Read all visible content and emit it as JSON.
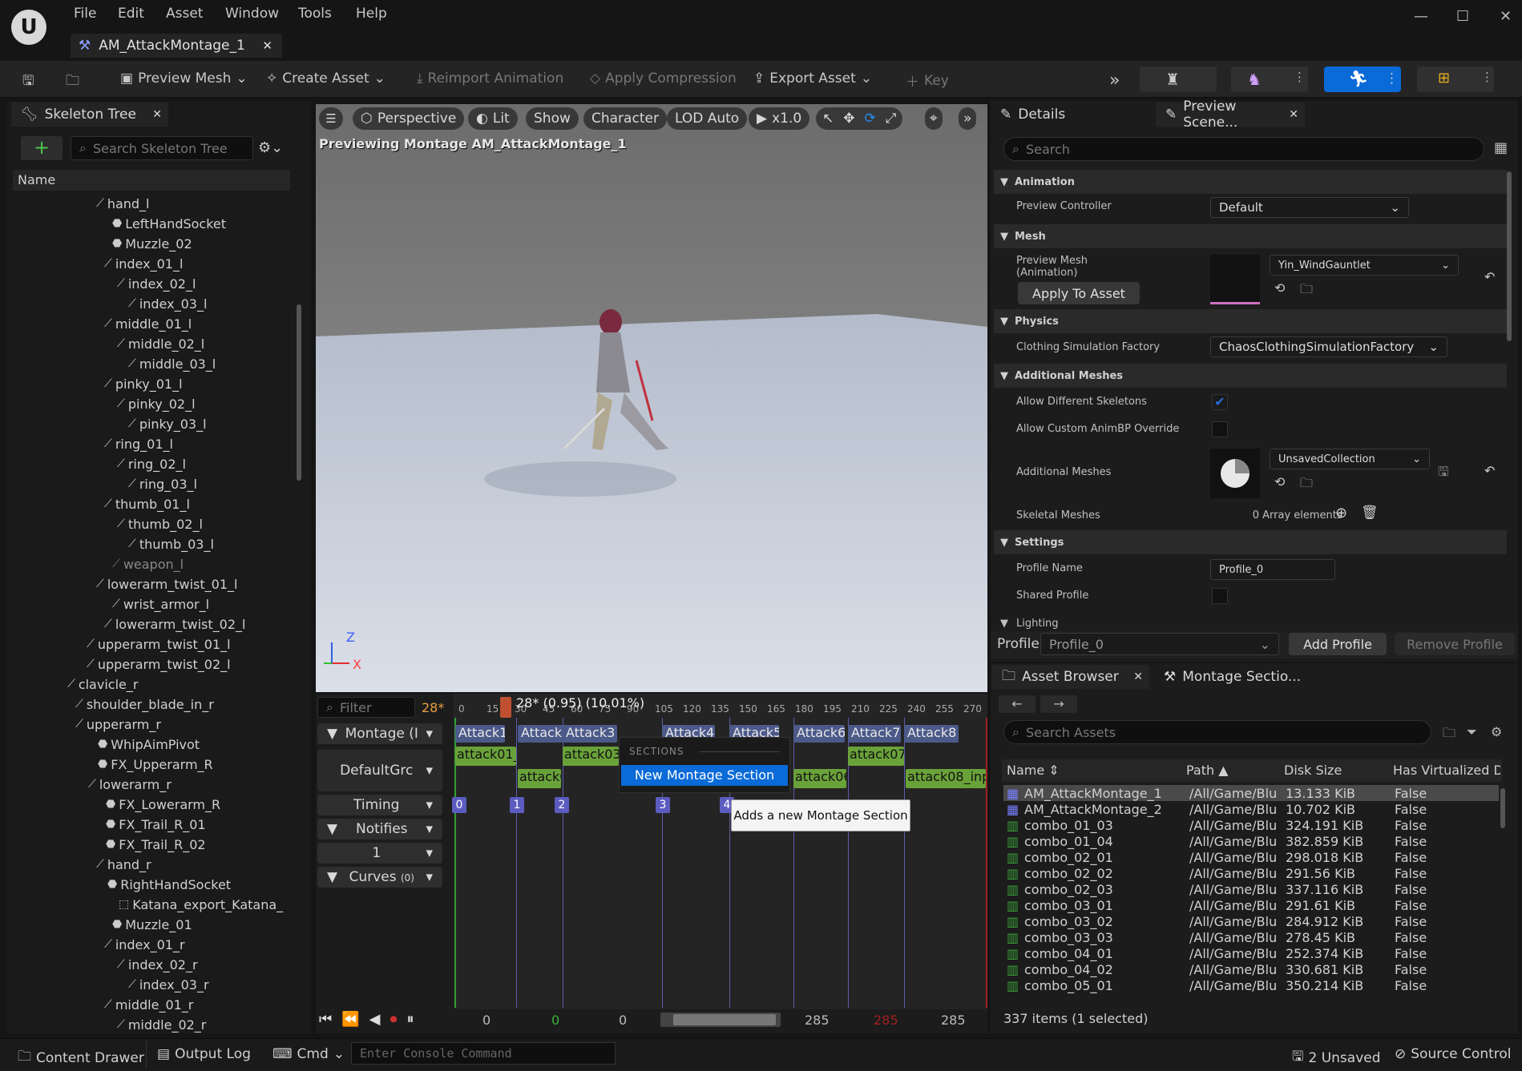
{
  "menu": {
    "items": [
      "File",
      "Edit",
      "Asset",
      "Window",
      "Tools",
      "Help"
    ]
  },
  "tab": {
    "title": "AM_AttackMontage_1"
  },
  "toolbar": {
    "preview_mesh": "Preview Mesh",
    "create_asset": "Create Asset",
    "reimport": "Reimport Animation",
    "apply_compression": "Apply Compression",
    "export_asset": "Export Asset",
    "key": "Key"
  },
  "skeleton_tree": {
    "tab": "Skeleton Tree",
    "search_placeholder": "Search Skeleton Tree",
    "column": "Name",
    "rows": [
      {
        "label": "hand_l",
        "type": "bone"
      },
      {
        "label": "LeftHandSocket",
        "type": "socket"
      },
      {
        "label": "Muzzle_02",
        "type": "socket"
      },
      {
        "label": "index_01_l",
        "type": "bone"
      },
      {
        "label": "index_02_l",
        "type": "bone"
      },
      {
        "label": "index_03_l",
        "type": "bone"
      },
      {
        "label": "middle_01_l",
        "type": "bone"
      },
      {
        "label": "middle_02_l",
        "type": "bone"
      },
      {
        "label": "middle_03_l",
        "type": "bone"
      },
      {
        "label": "pinky_01_l",
        "type": "bone"
      },
      {
        "label": "pinky_02_l",
        "type": "bone"
      },
      {
        "label": "pinky_03_l",
        "type": "bone"
      },
      {
        "label": "ring_01_l",
        "type": "bone"
      },
      {
        "label": "ring_02_l",
        "type": "bone"
      },
      {
        "label": "ring_03_l",
        "type": "bone"
      },
      {
        "label": "thumb_01_l",
        "type": "bone"
      },
      {
        "label": "thumb_02_l",
        "type": "bone"
      },
      {
        "label": "thumb_03_l",
        "type": "bone"
      },
      {
        "label": "weapon_l",
        "type": "bone-dim"
      },
      {
        "label": "lowerarm_twist_01_l",
        "type": "bone"
      },
      {
        "label": "wrist_armor_l",
        "type": "bone"
      },
      {
        "label": "lowerarm_twist_02_l",
        "type": "bone"
      },
      {
        "label": "upperarm_twist_01_l",
        "type": "bone"
      },
      {
        "label": "upperarm_twist_02_l",
        "type": "bone"
      },
      {
        "label": "clavicle_r",
        "type": "bone"
      },
      {
        "label": "shoulder_blade_in_r",
        "type": "bone"
      },
      {
        "label": "upperarm_r",
        "type": "bone"
      },
      {
        "label": "WhipAimPivot",
        "type": "socket"
      },
      {
        "label": "FX_Upperarm_R",
        "type": "socket"
      },
      {
        "label": "lowerarm_r",
        "type": "bone"
      },
      {
        "label": "FX_Lowerarm_R",
        "type": "socket"
      },
      {
        "label": "FX_Trail_R_01",
        "type": "socket"
      },
      {
        "label": "FX_Trail_R_02",
        "type": "socket"
      },
      {
        "label": "hand_r",
        "type": "bone"
      },
      {
        "label": "RightHandSocket",
        "type": "socket"
      },
      {
        "label": "Katana_export_Katana_",
        "type": "mesh"
      },
      {
        "label": "Muzzle_01",
        "type": "socket"
      },
      {
        "label": "index_01_r",
        "type": "bone"
      },
      {
        "label": "index_02_r",
        "type": "bone"
      },
      {
        "label": "index_03_r",
        "type": "bone"
      },
      {
        "label": "middle_01_r",
        "type": "bone"
      },
      {
        "label": "middle_02_r",
        "type": "bone"
      }
    ]
  },
  "viewport": {
    "buttons": [
      "Perspective",
      "Lit",
      "Show",
      "Character",
      "LOD Auto",
      "x1.0"
    ],
    "overlay": "Previewing Montage AM_AttackMontage_1",
    "axis_z": "Z",
    "axis_x": "X"
  },
  "details": {
    "tab": "Details",
    "tab2": "Preview Scene...",
    "search_placeholder": "Search",
    "sections": {
      "animation": "Animation",
      "mesh": "Mesh",
      "physics": "Physics",
      "additional_meshes": "Additional Meshes",
      "settings": "Settings",
      "lighting": "Lighting"
    },
    "preview_controller_label": "Preview Controller",
    "preview_controller_value": "Default",
    "preview_mesh_label": "Preview Mesh",
    "preview_mesh_sub": "(Animation)",
    "preview_mesh_value": "Yin_WindGauntlet",
    "apply_to_asset": "Apply To Asset",
    "clothing_label": "Clothing Simulation Factory",
    "clothing_value": "ChaosClothingSimulationFactory",
    "allow_diff_skel": "Allow Different Skeletons",
    "allow_custom_animbp": "Allow Custom AnimBP Override",
    "additional_meshes_label": "Additional Meshes",
    "additional_meshes_value": "UnsavedCollection",
    "skeletal_meshes_label": "Skeletal Meshes",
    "skeletal_meshes_value": "0 Array elements",
    "profile_name_label": "Profile Name",
    "profile_name_value": "Profile_0",
    "shared_profile": "Shared Profile",
    "profile_label": "Profile",
    "profile_value": "Profile_0",
    "add_profile": "Add Profile",
    "remove_profile": "Remove Profile"
  },
  "asset_browser": {
    "tab": "Asset Browser",
    "tab2": "Montage Sectio...",
    "search_placeholder": "Search Assets",
    "columns": [
      "Name",
      "Path",
      "Disk Size",
      "Has Virtualized D"
    ],
    "rows": [
      {
        "name": "AM_AttackMontage_1",
        "path": "/All/Game/Blu",
        "size": "13.133 KiB",
        "virt": "False",
        "kind": "montage"
      },
      {
        "name": "AM_AttackMontage_2",
        "path": "/All/Game/Blu",
        "size": "10.702 KiB",
        "virt": "False",
        "kind": "montage"
      },
      {
        "name": "combo_01_03",
        "path": "/All/Game/Blu",
        "size": "324.191 KiB",
        "virt": "False",
        "kind": "anim"
      },
      {
        "name": "combo_01_04",
        "path": "/All/Game/Blu",
        "size": "382.859 KiB",
        "virt": "False",
        "kind": "anim"
      },
      {
        "name": "combo_02_01",
        "path": "/All/Game/Blu",
        "size": "298.018 KiB",
        "virt": "False",
        "kind": "anim"
      },
      {
        "name": "combo_02_02",
        "path": "/All/Game/Blu",
        "size": "291.56 KiB",
        "virt": "False",
        "kind": "anim"
      },
      {
        "name": "combo_02_03",
        "path": "/All/Game/Blu",
        "size": "337.116 KiB",
        "virt": "False",
        "kind": "anim"
      },
      {
        "name": "combo_03_01",
        "path": "/All/Game/Blu",
        "size": "291.61 KiB",
        "virt": "False",
        "kind": "anim"
      },
      {
        "name": "combo_03_02",
        "path": "/All/Game/Blu",
        "size": "284.912 KiB",
        "virt": "False",
        "kind": "anim"
      },
      {
        "name": "combo_03_03",
        "path": "/All/Game/Blu",
        "size": "278.45 KiB",
        "virt": "False",
        "kind": "anim"
      },
      {
        "name": "combo_04_01",
        "path": "/All/Game/Blu",
        "size": "252.374 KiB",
        "virt": "False",
        "kind": "anim"
      },
      {
        "name": "combo_04_02",
        "path": "/All/Game/Blu",
        "size": "330.681 KiB",
        "virt": "False",
        "kind": "anim"
      },
      {
        "name": "combo_05_01",
        "path": "/All/Game/Blu",
        "size": "350.214 KiB",
        "virt": "False",
        "kind": "anim"
      }
    ],
    "count": "337 items (1 selected)"
  },
  "timeline": {
    "filter_placeholder": "Filter",
    "frame": "28*",
    "scrub_label": "28* (0.95) (10.01%)",
    "ruler": [
      "0",
      "15",
      "30",
      "45",
      "60",
      "75",
      "90",
      "105",
      "120",
      "135",
      "150",
      "165",
      "180",
      "195",
      "210",
      "225",
      "240",
      "255",
      "270"
    ],
    "tracks": {
      "montage": "Montage (I",
      "default_group": "DefaultGrc",
      "timing": "Timing",
      "notifies": "Notifies",
      "notify_track": "1",
      "curves": "Curves",
      "curves_count": "(0)"
    },
    "sections": [
      "Attack1",
      "Attack",
      "Attack3",
      "Attack4",
      "Attack5",
      "Attack6",
      "Attack7",
      "Attack8"
    ],
    "segments": [
      "attack01_",
      "attack03",
      "attack0",
      "attack06",
      "attack07",
      "attack08_inp"
    ],
    "timing_markers": [
      "0",
      "1",
      "2",
      "3",
      "4"
    ],
    "transport": {
      "start": "0",
      "a": "0",
      "b": "0",
      "end1": "285",
      "end2": "285",
      "end3": "285"
    }
  },
  "context_menu": {
    "header": "SECTIONS",
    "item": "New Montage Section",
    "tooltip": "Adds a new Montage Section"
  },
  "statusbar": {
    "content_drawer": "Content Drawer",
    "output_log": "Output Log",
    "cmd": "Cmd",
    "console_placeholder": "Enter Console Command",
    "unsaved": "2 Unsaved",
    "source_control": "Source Control"
  },
  "colors": {
    "accent": "#0a6ad8",
    "checkbox": "#2a6cd8",
    "section_blue": "#4c5a8a",
    "segment_green": "#6aa23a"
  }
}
